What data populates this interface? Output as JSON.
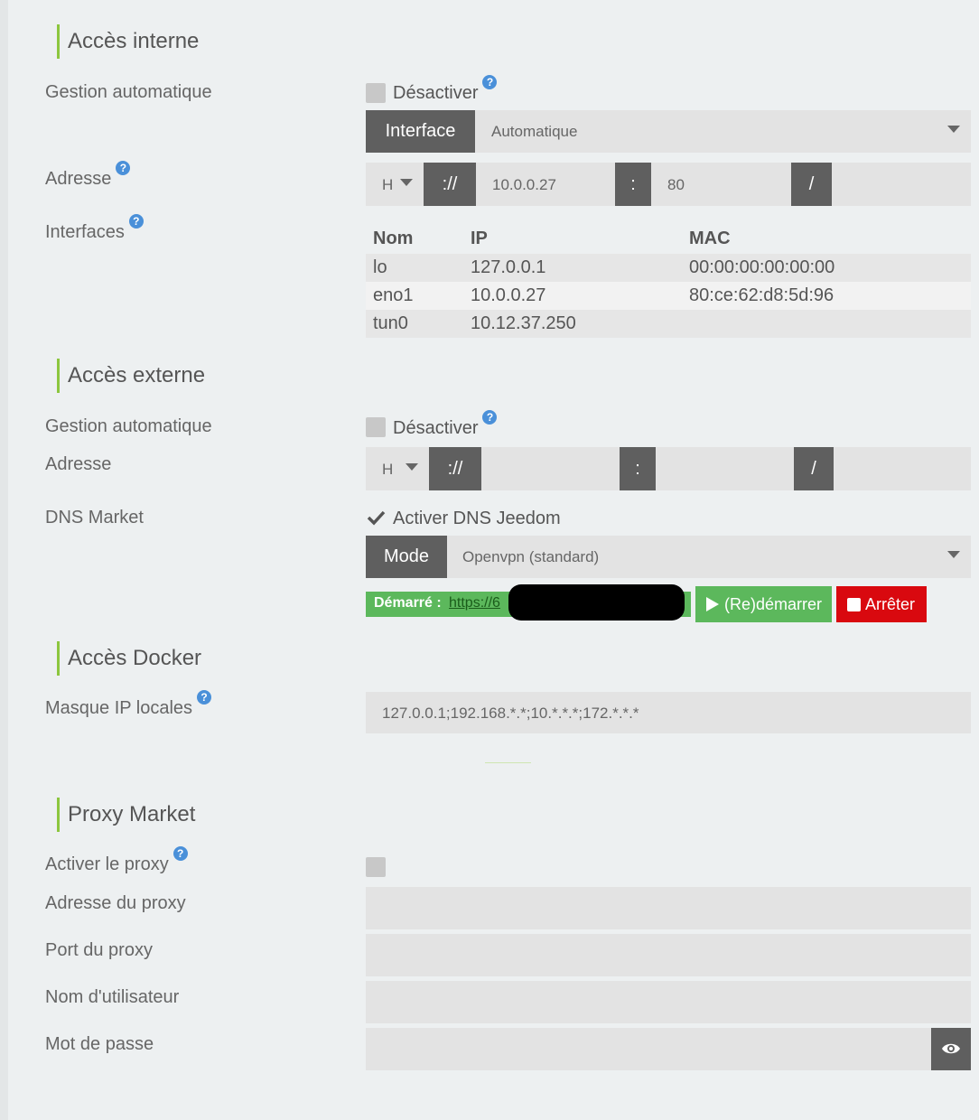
{
  "internal": {
    "title": "Accès interne",
    "auto_label": "Gestion automatique",
    "disable_label": "Désactiver",
    "interface_btn": "Interface",
    "interface_value": "Automatique",
    "address_label": "Adresse",
    "protocol": "H",
    "scheme_sep": "://",
    "ip": "10.0.0.27",
    "port_sep": ":",
    "port": "80",
    "path_sep": "/",
    "interfaces_label": "Interfaces",
    "table_headers": [
      "Nom",
      "IP",
      "MAC"
    ],
    "table_rows": [
      [
        "lo",
        "127.0.0.1",
        "00:00:00:00:00:00"
      ],
      [
        "eno1",
        "10.0.0.27",
        "80:ce:62:d8:5d:96"
      ],
      [
        "tun0",
        "10.12.37.250",
        ""
      ]
    ]
  },
  "external": {
    "title": "Accès externe",
    "auto_label": "Gestion automatique",
    "disable_label": "Désactiver",
    "address_label": "Adresse",
    "protocol": "H",
    "scheme_sep": "://",
    "port_sep": ":",
    "path_sep": "/",
    "dns_label": "DNS Market",
    "dns_checkbox_label": "Activer DNS Jeedom",
    "mode_btn": "Mode",
    "mode_value": "Openvpn (standard)",
    "status_prefix": "Démarré :",
    "status_link": "https://6",
    "restart_label": "(Re)démarrer",
    "stop_label": "Arrêter"
  },
  "docker": {
    "title": "Accès Docker",
    "mask_label": "Masque IP locales",
    "mask_value": "127.0.0.1;192.168.*.*;10.*.*.*;172.*.*.*"
  },
  "proxy": {
    "title": "Proxy Market",
    "enable_label": "Activer le proxy",
    "address_label": "Adresse du proxy",
    "port_label": "Port du proxy",
    "user_label": "Nom d'utilisateur",
    "password_label": "Mot de passe"
  },
  "help_glyph": "?",
  "colors": {
    "accent_green": "#8cc63e",
    "status_green": "#5cb85c",
    "stop_red": "#d9090f",
    "dark_button": "#5f5f5f",
    "help_blue": "#4a90d9"
  }
}
